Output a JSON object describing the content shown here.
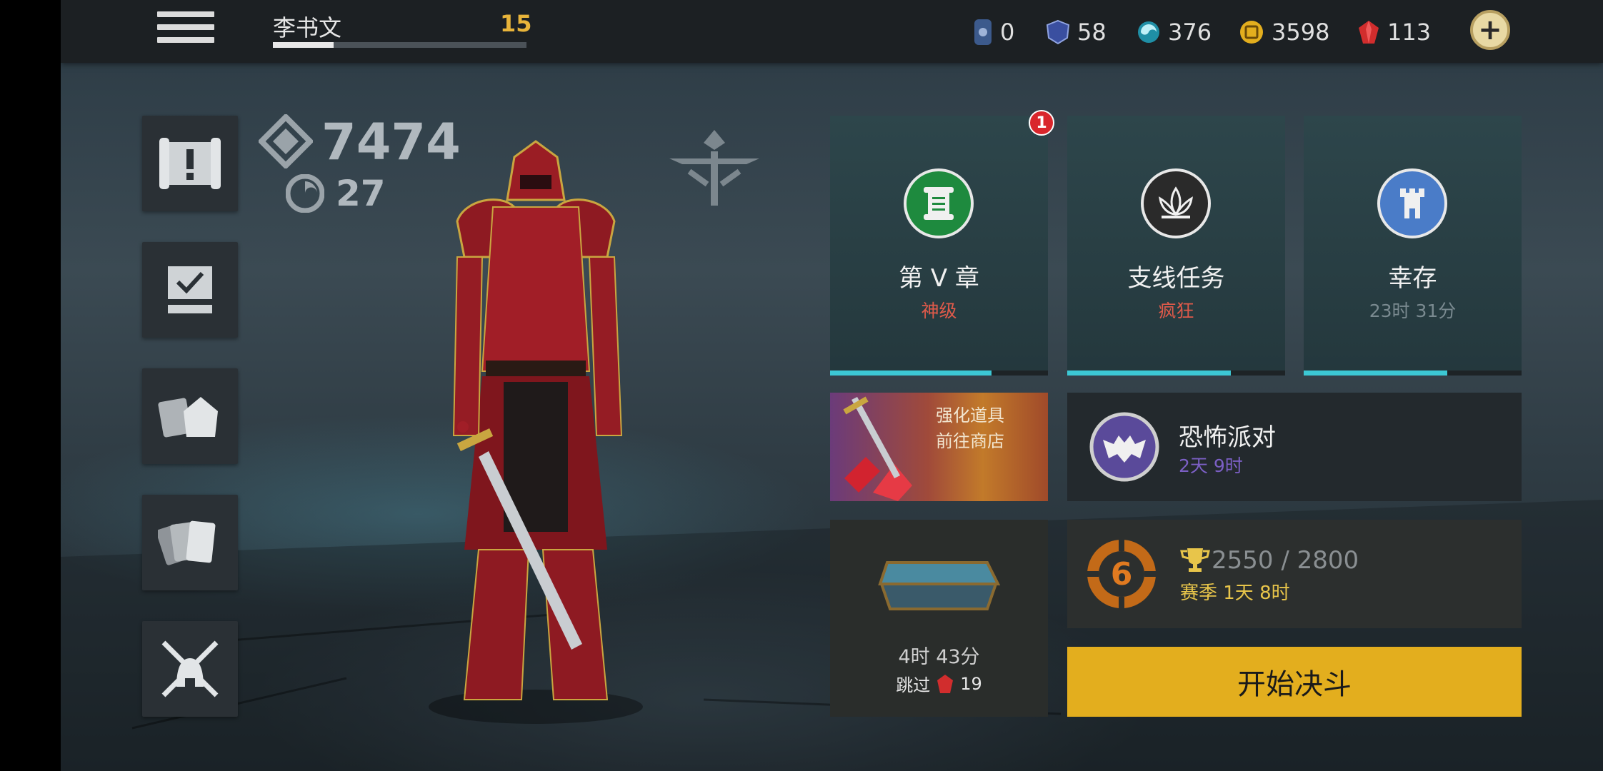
{
  "player": {
    "name": "李书文",
    "level": "15",
    "xp_progress": 0.24
  },
  "currencies": [
    {
      "icon": "key-icon",
      "value": "0"
    },
    {
      "icon": "shield-icon",
      "value": "58"
    },
    {
      "icon": "spirit-orb-icon",
      "value": "376"
    },
    {
      "icon": "coin-icon",
      "value": "3598"
    },
    {
      "icon": "ruby-gem-icon",
      "value": "113"
    }
  ],
  "stats": {
    "power": "7474",
    "mastery": "27"
  },
  "modes": [
    {
      "title": "第 V 章",
      "subtitle": "神级",
      "subtitle_color": "#e05a4a",
      "icon": "scroll-icon",
      "icon_bg": "#1e8a3e",
      "progress": 0.74,
      "badge": "1"
    },
    {
      "title": "支线任务",
      "subtitle": "疯狂",
      "subtitle_color": "#e05a4a",
      "icon": "lotus-icon",
      "icon_bg": "#2a2a2a",
      "progress": 0.75
    },
    {
      "title": "幸存",
      "subtitle": "23时 31分",
      "subtitle_color": "#7a8a90",
      "icon": "tower-icon",
      "icon_bg": "#4a7cc8",
      "progress": 0.66
    }
  ],
  "shop": {
    "line1": "强化道具",
    "line2": "前往商店"
  },
  "event": {
    "title": "恐怖派对",
    "time": "2天 9时"
  },
  "chest": {
    "time": "4时 43分",
    "skip_label": "跳过",
    "skip_cost": "19"
  },
  "league": {
    "rank": "6",
    "score": "2550 / 2800",
    "season": "赛季 1天 8时"
  },
  "duel_button": "开始决斗"
}
